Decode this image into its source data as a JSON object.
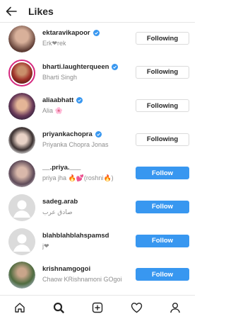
{
  "header": {
    "title": "Likes"
  },
  "rows": [
    {
      "username": "ektaravikapoor",
      "verified": true,
      "fullname": "Erk❤rek",
      "button": "Following",
      "state": "following",
      "avatar_color": "#7a5a52"
    },
    {
      "username": "bharti.laughterqueen",
      "verified": true,
      "fullname": "Bharti Singh",
      "button": "Following",
      "state": "following",
      "avatar_color": "#8c3b30"
    },
    {
      "username": "aliaabhatt",
      "verified": true,
      "fullname": "Alia 🌸",
      "button": "Following",
      "state": "following",
      "avatar_color": "#3b2a4f"
    },
    {
      "username": "priyankachopra",
      "verified": true,
      "fullname": "Priyanka Chopra Jonas",
      "button": "Following",
      "state": "following",
      "avatar_color": "#d9d9d9"
    },
    {
      "username": "__.priya.___",
      "verified": false,
      "fullname": "priya jha 🔥💕(roshni🔥)",
      "button": "Follow",
      "state": "follow",
      "avatar_color": "#8a7a86"
    },
    {
      "username": "sadeg.arab",
      "verified": false,
      "fullname": "صادق عرب",
      "button": "Follow",
      "state": "follow",
      "avatar_color": "#dbdbdb"
    },
    {
      "username": "blahblahblahspamsd",
      "verified": false,
      "fullname": "j❤",
      "button": "Follow",
      "state": "follow",
      "avatar_color": "#dbdbdb"
    },
    {
      "username": "krishnamgogoi",
      "verified": false,
      "fullname": "Chaow KRishnamoni GOgoi",
      "button": "Follow",
      "state": "follow",
      "avatar_color": "#5d7a4a"
    }
  ],
  "tabs": [
    "home-icon",
    "search-icon",
    "new-post-icon",
    "activity-heart-icon",
    "profile-icon"
  ],
  "colors": {
    "follow_blue": "#3897f0",
    "verified_blue": "#3897f0",
    "story_ring": "#d6297f"
  }
}
